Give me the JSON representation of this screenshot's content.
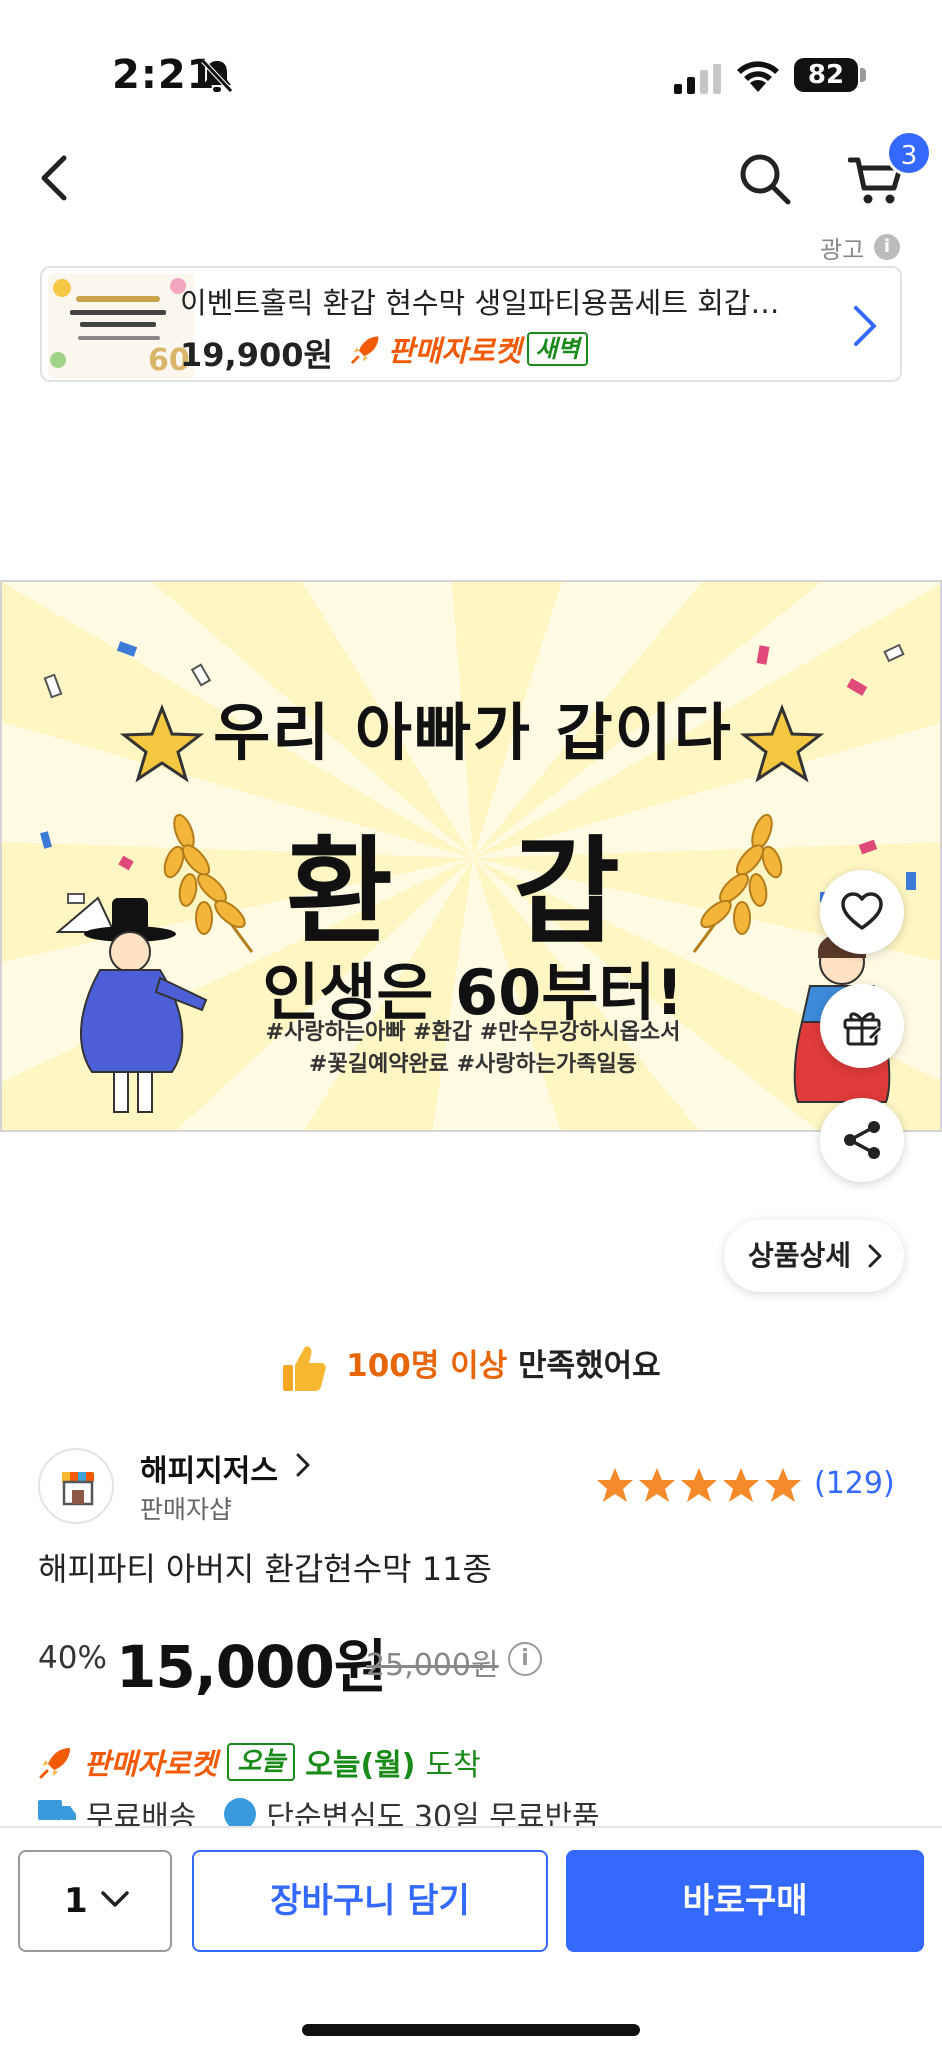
{
  "status_bar": {
    "time": "2:21",
    "battery": "82"
  },
  "nav": {
    "cart_count": "3"
  },
  "ad": {
    "label": "광고",
    "title": "이벤트홀릭 환갑 현수막 생일파티용품세트 회갑…",
    "price": "19,900원",
    "rocket_label": "판매자로켓",
    "delivery_badge": "새벽"
  },
  "banner": {
    "line1": "우리 아빠가 갑이다",
    "line2": "환 갑",
    "line3": "인생은 60부터!",
    "tags_line1": "#사랑하는아빠 #환갑 #만수무강하시옵소서",
    "tags_line2": "#꽃길예약완료 #사랑하는가족일동"
  },
  "detail_button": "상품상세",
  "satisfaction": {
    "highlight": "100명 이상",
    "text": " 만족했어요"
  },
  "seller": {
    "name": "해피지저스",
    "subtitle": "판매자샵",
    "review_count": "(129)",
    "rating": 5
  },
  "product": {
    "title": "해피파티 아버지 환갑현수막 11종",
    "discount": "40%",
    "price": "15,000원",
    "original_price": "25,000원"
  },
  "delivery": {
    "rocket_label": "판매자로켓",
    "badge": "오늘",
    "arrive_date": "오늘(월)",
    "arrive_text": "도착",
    "free_shipping": "무료배송",
    "free_return": "단순변심도 30일 무료반품"
  },
  "bottom": {
    "quantity": "1",
    "cart_button": "장바구니 담기",
    "buy_button": "바로구매"
  },
  "colors": {
    "accent": "#3469ff",
    "rocket": "#f25a05",
    "green": "#1a8a1a",
    "highlight": "#e7660a"
  }
}
